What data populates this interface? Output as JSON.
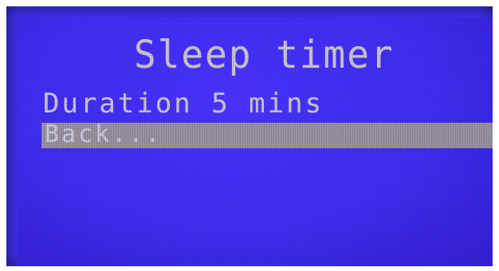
{
  "screen": {
    "title": "Sleep timer",
    "menu": [
      {
        "label": "Duration 5 mins",
        "selected": false
      },
      {
        "label": "Back...",
        "selected": true
      }
    ]
  },
  "colors": {
    "lcd_background": "#3f2cf2",
    "text": "#c9c6cf",
    "selection_bar": "#a7a39f"
  }
}
